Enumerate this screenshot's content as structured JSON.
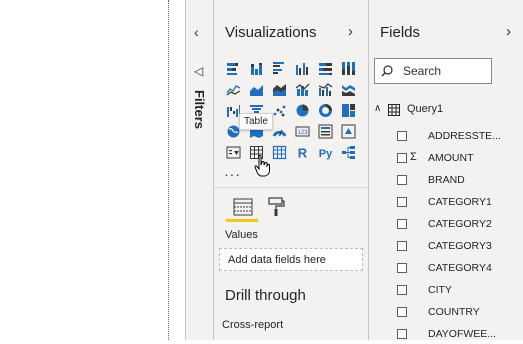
{
  "filters": {
    "label": "Filters"
  },
  "visualizations": {
    "title": "Visualizations",
    "icons": [
      [
        "stacked-bar-chart-icon",
        "stacked-column-chart-icon",
        "clustered-bar-chart-icon",
        "clustered-column-chart-icon",
        "100-stacked-bar-chart-icon",
        "100-stacked-column-chart-icon"
      ],
      [
        "line-chart-icon",
        "area-chart-icon",
        "stacked-area-chart-icon",
        "line-and-stacked-column-icon",
        "line-and-clustered-column-icon",
        "ribbon-chart-icon"
      ],
      [
        "waterfall-chart-icon",
        "funnel-icon",
        "scatter-chart-icon",
        "pie-chart-icon",
        "donut-chart-icon",
        "treemap-icon"
      ],
      [
        "map-icon",
        "filled-map-icon",
        "gauge-icon",
        "card-icon",
        "multi-row-card-icon",
        "kpi-icon"
      ],
      [
        "slicer-icon",
        "table-icon",
        "matrix-icon",
        "r-script-visual-icon",
        "python-visual-icon",
        "key-influencers-icon"
      ]
    ],
    "more": "···",
    "tooltip": "Table",
    "values_label": "Values",
    "add_field": "Add data fields here",
    "drill_title": "Drill through",
    "cross_report": "Cross-report"
  },
  "fields": {
    "title": "Fields",
    "search_placeholder": "Search",
    "query": "Query1",
    "items": [
      {
        "name": "ADDRESSTE...",
        "sigma": false
      },
      {
        "name": "AMOUNT",
        "sigma": true
      },
      {
        "name": "BRAND",
        "sigma": false
      },
      {
        "name": "CATEGORY1",
        "sigma": false
      },
      {
        "name": "CATEGORY2",
        "sigma": false
      },
      {
        "name": "CATEGORY3",
        "sigma": false
      },
      {
        "name": "CATEGORY4",
        "sigma": false
      },
      {
        "name": "CITY",
        "sigma": false
      },
      {
        "name": "COUNTRY",
        "sigma": false
      },
      {
        "name": "DAYOFWEE...",
        "sigma": false
      }
    ]
  },
  "colors": {
    "accent_yellow": "#f2c811",
    "icon_blue": "#1f6fc1",
    "icon_dark": "#3b3a39"
  }
}
